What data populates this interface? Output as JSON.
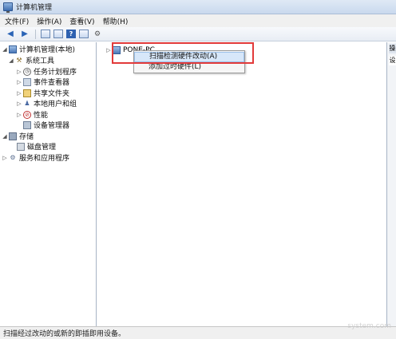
{
  "window": {
    "title": "计算机管理"
  },
  "menu": [
    "文件(F)",
    "操作(A)",
    "查看(V)",
    "帮助(H)"
  ],
  "tree": [
    {
      "label": "计算机管理(本地)",
      "icon": "computer-icon"
    },
    {
      "label": "系统工具",
      "icon": "tools-icon"
    },
    {
      "label": "任务计划程序",
      "icon": "clock-icon"
    },
    {
      "label": "事件查看器",
      "icon": "event-viewer-icon"
    },
    {
      "label": "共享文件夹",
      "icon": "shared-folder-icon"
    },
    {
      "label": "本地用户和组",
      "icon": "users-icon"
    },
    {
      "label": "性能",
      "icon": "performance-icon"
    },
    {
      "label": "设备管理器",
      "icon": "device-manager-icon"
    },
    {
      "label": "存储",
      "icon": "storage-icon"
    },
    {
      "label": "磁盘管理",
      "icon": "disk-icon"
    },
    {
      "label": "服务和应用程序",
      "icon": "services-icon"
    }
  ],
  "main": {
    "node_label": "PONE-PC",
    "context_menu": [
      "扫描检测硬件改动(A)",
      "添加过时硬件(L)"
    ]
  },
  "right_pane": {
    "tab1": "操",
    "tab2": "设"
  },
  "status": {
    "text": "扫描经过改动的或新的即插即用设备。"
  },
  "watermark": "system.com"
}
